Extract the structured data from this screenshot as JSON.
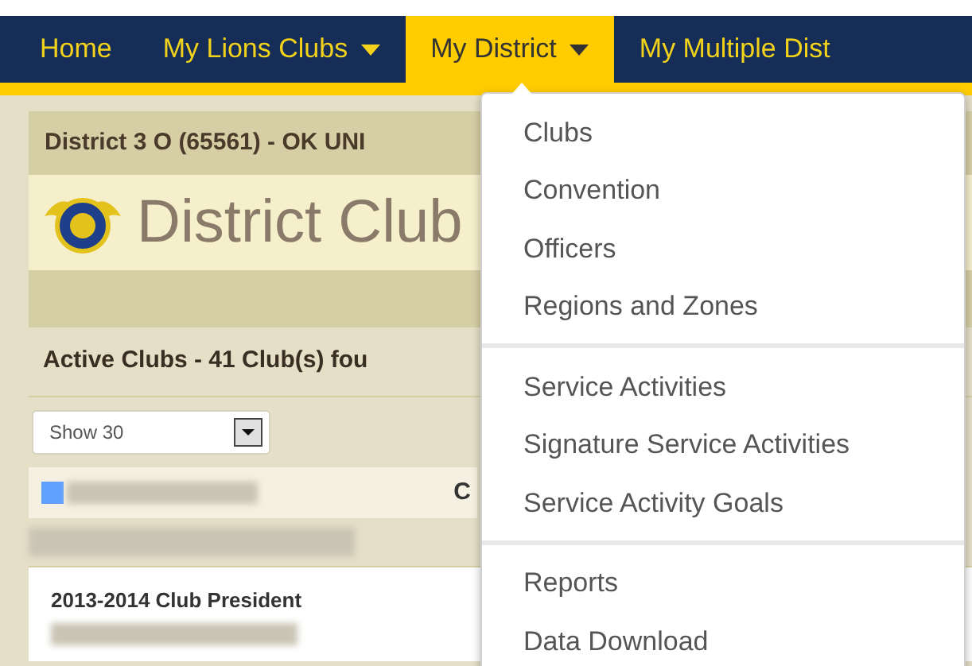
{
  "nav": {
    "items": [
      {
        "label": "Home",
        "caret": false,
        "selected": false
      },
      {
        "label": "My Lions Clubs",
        "caret": true,
        "selected": false
      },
      {
        "label": "My District",
        "caret": true,
        "selected": true
      },
      {
        "label": "My Multiple Dist",
        "caret": false,
        "selected": false
      }
    ]
  },
  "district_bar": "District 3 O (65561) - OK UNI",
  "page_title": "District Club",
  "active_clubs_heading": "Active Clubs - 41 Club(s) fou",
  "show_select": {
    "value": "Show 30"
  },
  "column_header": "C",
  "officer_title": "2013-2014 Club President",
  "dropdown": {
    "groups": [
      [
        "Clubs",
        "Convention",
        "Officers",
        "Regions and Zones"
      ],
      [
        "Service Activities",
        "Signature Service Activities",
        "Service Activity Goals"
      ],
      [
        "Reports",
        "Data Download"
      ]
    ]
  }
}
